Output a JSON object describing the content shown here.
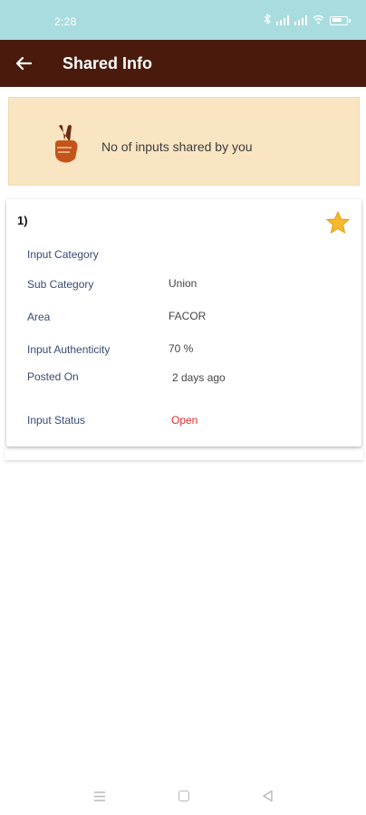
{
  "status_bar": {
    "time": "2:28",
    "icons": [
      "bluetooth-icon",
      "signal-icon",
      "signal-icon",
      "wifi-icon",
      "battery-icon"
    ]
  },
  "app_bar": {
    "title": "Shared Info",
    "back_icon": "arrow-left-icon"
  },
  "banner": {
    "text": "No of inputs shared by you",
    "icon": "victory-hand-icon"
  },
  "cards": [
    {
      "index": "1)",
      "favorite_icon": "star-icon",
      "rows": [
        {
          "label": "Input Category",
          "value": ""
        },
        {
          "label": "Sub Category",
          "value": "Union"
        },
        {
          "label": "Area",
          "value": "FACOR"
        },
        {
          "label": "Input Authenticity",
          "value": "70 %"
        },
        {
          "label": "Posted On",
          "value": "2 days ago"
        },
        {
          "label": "Input Status",
          "value": "Open"
        }
      ]
    }
  ],
  "nav_bar": {
    "icons": [
      "menu-icon",
      "home-icon",
      "back-icon"
    ]
  },
  "colors": {
    "status_bar": "#a9dcde",
    "app_bar": "#4a1b0c",
    "banner": "#fae5c3",
    "status_open": "#e02b2b",
    "label": "#3a4a74"
  }
}
